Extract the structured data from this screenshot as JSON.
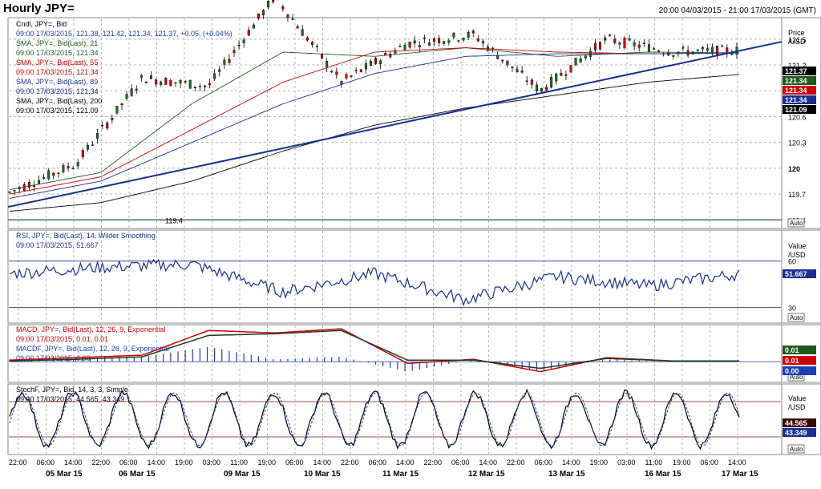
{
  "header": {
    "title": "Hourly JPY=",
    "range": "20:00 04/03/2015 - 21:00 17/03/2015 (GMT)"
  },
  "panels": {
    "price": {
      "axis_title_1": "Price",
      "axis_title_2": "/USD",
      "ticks": [
        "121.5",
        "121.2",
        "120.9",
        "120.6",
        "120.3",
        "120",
        "119.7",
        "119.4"
      ],
      "auto": "Auto",
      "hline_label": "119.4",
      "legend": [
        {
          "text": "Cndl, JPY=, Bid",
          "color": "#000000"
        },
        {
          "text": "09:00 17/03/2015, 121.38, 121.42, 121.34, 121.37, +0.05, (+0.04%)",
          "color": "#1a3fb5"
        },
        {
          "text": "SMA, JPY=, Bid(Last), 21",
          "color": "#1e5a1e"
        },
        {
          "text": "09:00 17/03/2015, 121.34",
          "color": "#1e5a1e"
        },
        {
          "text": "SMA, JPY=, Bid(Last), 55",
          "color": "#cc0000"
        },
        {
          "text": "09:00 17/03/2015, 121.34",
          "color": "#cc0000"
        },
        {
          "text": "SMA, JPY=, Bid(Last), 89",
          "color": "#1a2f8f"
        },
        {
          "text": "09:00 17/03/2015, 121.34",
          "color": "#1a2f8f"
        },
        {
          "text": "SMA, JPY=, Bid(Last), 200",
          "color": "#000000"
        },
        {
          "text": "09:00 17/03/2015, 121.09",
          "color": "#000000"
        }
      ],
      "last_labels": [
        {
          "text": "121.37",
          "bg": "#000000"
        },
        {
          "text": "121.34",
          "bg": "#1e5a1e"
        },
        {
          "text": "121.34",
          "bg": "#cc0000"
        },
        {
          "text": "121.34",
          "bg": "#1a2f8f"
        },
        {
          "text": "121.09",
          "bg": "#000000"
        }
      ]
    },
    "rsi": {
      "axis_title_1": "Value",
      "axis_title_2": "/USD",
      "ticks": [
        "60",
        "30"
      ],
      "auto": "Auto",
      "legend": [
        {
          "text": "RSI, JPY=, Bid(Last), 14, Wilder Smoothing",
          "color": "#1a2f8f"
        },
        {
          "text": "09:00 17/03/2015, 51.667",
          "color": "#1a2f8f"
        }
      ],
      "last_label": "51.667"
    },
    "macd": {
      "auto": "Auto",
      "legend": [
        {
          "text": "MACD, JPY=, Bid(Last), 12, 26, 9, Exponential",
          "color": "#cc0000"
        },
        {
          "text": "09:00 17/03/2015, 0.01, 0.01",
          "color": "#cc0000"
        },
        {
          "text": "MACDF, JPY=, Bid(Last), 12, 26, 9, Exponential",
          "color": "#1a3fb5"
        },
        {
          "text": "09:00 17/03/2015, 0.00",
          "color": "#1a3fb5"
        }
      ],
      "last_labels": [
        {
          "text": "0.01",
          "bg": "#1e5a1e"
        },
        {
          "text": "0.01",
          "bg": "#cc0000"
        },
        {
          "text": "0.00",
          "bg": "#1a3fb5"
        }
      ]
    },
    "stoch": {
      "axis_title_1": "Value",
      "axis_title_2": "/USD",
      "auto": "Auto",
      "legend": [
        {
          "text": "StochF, JPY=, Bid, 14, 3, 3, Simple",
          "color": "#000000"
        },
        {
          "text": "09:00 17/03/2015, 44.565, 43.349",
          "color": "#000000"
        }
      ],
      "last_labels": [
        {
          "text": "44.565",
          "bg": "#3a0a0a"
        },
        {
          "text": "43.349",
          "bg": "#1a2f8f"
        }
      ]
    }
  },
  "time_axis": {
    "hours": [
      "22:00",
      "06:00",
      "14:00",
      "22:00",
      "06:00",
      "14:00",
      "19:00",
      "03:00",
      "11:00",
      "19:00",
      "06:00",
      "14:00",
      "22:00",
      "06:00",
      "14:00",
      "22:00",
      "06:00",
      "14:00",
      "22:00",
      "06:00",
      "14:00",
      "19:00",
      "03:00",
      "11:00",
      "19:00",
      "06:00",
      "14:00"
    ],
    "dates": [
      "05 Mar 15",
      "06 Mar 15",
      "09 Mar 15",
      "10 Mar 15",
      "11 Mar 15",
      "12 Mar 15",
      "13 Mar 15",
      "16 Mar 15",
      "17 Mar 15"
    ]
  },
  "chart_data": {
    "type": "line",
    "series": [
      {
        "name": "Cndl, JPY=, Bid",
        "x": [
          "05 Mar 15",
          "06 Mar 15",
          "06 Mar 15",
          "09 Mar 15",
          "10 Mar 15",
          "10 Mar 15",
          "11 Mar 15",
          "12 Mar 15",
          "12 Mar 15",
          "13 Mar 15",
          "16 Mar 15",
          "17 Mar 15"
        ],
        "values": [
          119.72,
          120.05,
          121.05,
          120.95,
          122.0,
          121.0,
          121.45,
          121.55,
          120.9,
          121.5,
          121.35,
          121.37
        ]
      },
      {
        "name": "SMA, JPY=, Bid(Last), 21",
        "x": [
          "05 Mar 15",
          "06 Mar 15",
          "09 Mar 15",
          "10 Mar 15",
          "11 Mar 15",
          "12 Mar 15",
          "13 Mar 15",
          "16 Mar 15",
          "17 Mar 15"
        ],
        "values": [
          119.75,
          119.95,
          120.75,
          121.35,
          121.3,
          121.4,
          121.3,
          121.35,
          121.34
        ]
      },
      {
        "name": "SMA, JPY=, Bid(Last), 55",
        "x": [
          "05 Mar 15",
          "06 Mar 15",
          "09 Mar 15",
          "10 Mar 15",
          "11 Mar 15",
          "12 Mar 15",
          "13 Mar 15",
          "16 Mar 15",
          "17 Mar 15"
        ],
        "values": [
          119.7,
          119.9,
          120.45,
          121.0,
          121.35,
          121.4,
          121.35,
          121.33,
          121.34
        ]
      },
      {
        "name": "SMA, JPY=, Bid(Last), 89",
        "x": [
          "05 Mar 15",
          "06 Mar 15",
          "09 Mar 15",
          "10 Mar 15",
          "11 Mar 15",
          "12 Mar 15",
          "13 Mar 15",
          "16 Mar 15",
          "17 Mar 15"
        ],
        "values": [
          119.65,
          119.85,
          120.3,
          120.75,
          121.1,
          121.3,
          121.33,
          121.33,
          121.34
        ]
      },
      {
        "name": "SMA, JPY=, Bid(Last), 200",
        "x": [
          "05 Mar 15",
          "06 Mar 15",
          "09 Mar 15",
          "10 Mar 15",
          "11 Mar 15",
          "12 Mar 15",
          "13 Mar 15",
          "16 Mar 15",
          "17 Mar 15"
        ],
        "values": [
          119.5,
          119.6,
          119.85,
          120.2,
          120.5,
          120.7,
          120.85,
          121.0,
          121.09
        ]
      },
      {
        "name": "RSI, JPY=, Bid(Last), 14, Wilder Smoothing",
        "x": [
          "05 Mar 15",
          "06 Mar 15",
          "09 Mar 15",
          "10 Mar 15",
          "11 Mar 15",
          "12 Mar 15",
          "13 Mar 15",
          "16 Mar 15",
          "17 Mar 15"
        ],
        "values": [
          52,
          56,
          58,
          40,
          52,
          35,
          50,
          44,
          51.667
        ]
      },
      {
        "name": "StochF, JPY=, Bid, 14, 3, 3, Simple",
        "x": [
          "05 Mar 15",
          "06 Mar 15",
          "09 Mar 15",
          "10 Mar 15",
          "11 Mar 15",
          "12 Mar 15",
          "13 Mar 15",
          "16 Mar 15",
          "17 Mar 15"
        ],
        "values": [
          70,
          20,
          90,
          10,
          85,
          5,
          90,
          20,
          44.565
        ]
      }
    ],
    "price_ylim": [
      119.3,
      121.75
    ],
    "rsi_ylim": [
      20,
      80
    ],
    "macd_ylim": [
      -0.25,
      0.45
    ],
    "stoch_ylim": [
      -10,
      110
    ],
    "hline": 119.4,
    "grid": true,
    "legend_position": "top-left"
  }
}
